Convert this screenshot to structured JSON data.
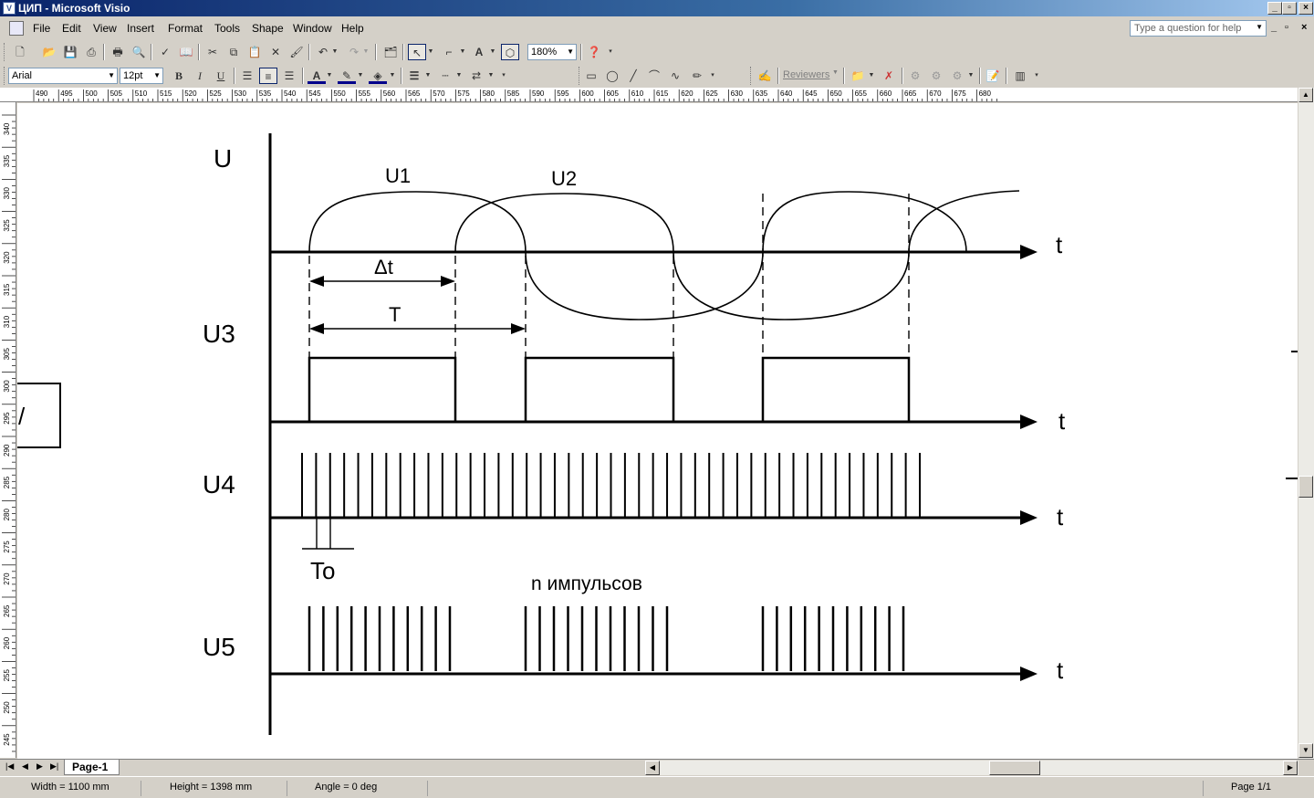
{
  "window": {
    "title": "ЦИП - Microsoft Visio"
  },
  "menu": [
    "File",
    "Edit",
    "View",
    "Insert",
    "Format",
    "Tools",
    "Shape",
    "Window",
    "Help"
  ],
  "help_placeholder": "Type a question for help",
  "toolbar": {
    "zoom": "180%",
    "font": "Arial",
    "font_size": "12pt",
    "bold": "B",
    "italic": "I",
    "underline": "U",
    "reviewers": "Reviewers"
  },
  "ruler_h_labels": [
    "490",
    "495",
    "500",
    "505",
    "510",
    "515",
    "520",
    "525",
    "530",
    "535",
    "540",
    "545",
    "550",
    "555",
    "560",
    "565",
    "570",
    "575",
    "580",
    "585",
    "590",
    "595",
    "600",
    "605",
    "610",
    "615",
    "620",
    "625",
    "630",
    "635",
    "640",
    "645",
    "650",
    "655",
    "660",
    "665",
    "670",
    "675",
    "680"
  ],
  "ruler_v_labels": [
    "340",
    "335",
    "330",
    "325",
    "320",
    "315",
    "310",
    "305",
    "300",
    "295",
    "290",
    "285",
    "280",
    "275",
    "270",
    "265",
    "260",
    "255",
    "250",
    "245"
  ],
  "diagram": {
    "u_label": "U",
    "u1": "U1",
    "u2": "U2",
    "u3": "U3",
    "u4": "U4",
    "u5": "U5",
    "t": "t",
    "delta_t": "Δt",
    "period": "T",
    "to": "To",
    "n_pulses": "n импульсов",
    "partial_shape_text": "/"
  },
  "page_tab": "Page-1",
  "status": {
    "width": "Width = 1100 mm",
    "height": "Height = 1398 mm",
    "angle": "Angle = 0 deg",
    "page": "Page 1/1"
  }
}
